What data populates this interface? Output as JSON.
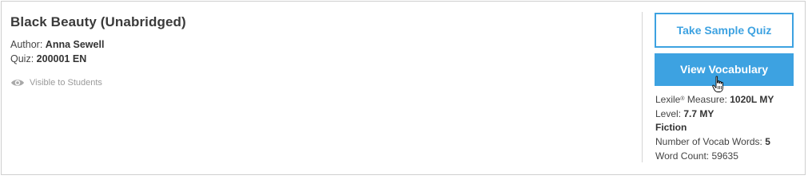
{
  "book": {
    "title": "Black Beauty (Unabridged)",
    "author_label": "Author:",
    "author": "Anna Sewell",
    "quiz_label": "Quiz:",
    "quiz": "200001 EN",
    "visibility_text": "Visible to Students",
    "visibility_icon": "eye-icon"
  },
  "actions": {
    "sample_quiz_label": "Take Sample Quiz",
    "vocabulary_label": "View Vocabulary",
    "accent_color": "#3da2e1"
  },
  "stats": {
    "lexile_label": "Lexile",
    "lexile_reg": "®",
    "lexile_label_suffix": " Measure:",
    "lexile_value": "1020L MY",
    "level_label": "Level:",
    "level_value": "7.7 MY",
    "genre": "Fiction",
    "vocab_words_label": "Number of Vocab Words:",
    "vocab_words_value": "5",
    "word_count_label": "Word Count:",
    "word_count_value": "59635"
  }
}
